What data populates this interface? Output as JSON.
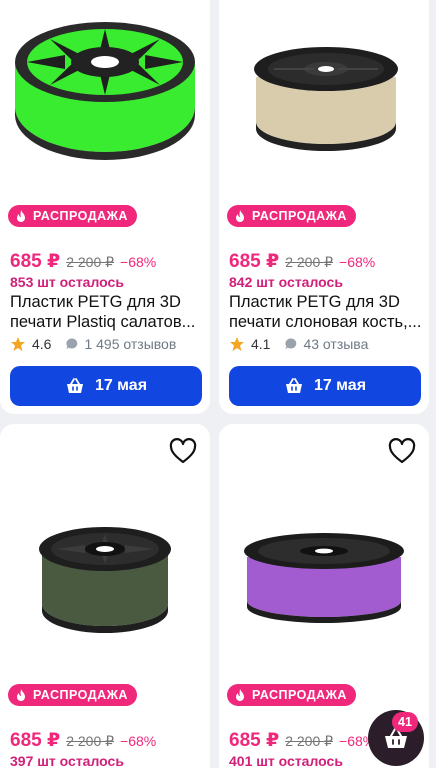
{
  "products": [
    {
      "badge": "РАСПРОДАЖА",
      "price": "685 ₽",
      "old_price": "2 200 ₽",
      "discount": "−68%",
      "stock": "853 шт осталось",
      "title_line1": "Пластик PETG для 3D",
      "title_line2": "печати Plastiq салатов...",
      "rating": "4.6",
      "reviews": "1 495 отзывов",
      "button": "17 мая",
      "filament_color": "#39ec30"
    },
    {
      "badge": "РАСПРОДАЖА",
      "price": "685 ₽",
      "old_price": "2 200 ₽",
      "discount": "−68%",
      "stock": "842 шт осталось",
      "title_line1": "Пластик PETG для 3D",
      "title_line2": "печати слоновая кость,...",
      "rating": "4.1",
      "reviews": "43 отзыва",
      "button": "17 мая",
      "filament_color": "#d9ccad"
    },
    {
      "badge": "РАСПРОДАЖА",
      "price": "685 ₽",
      "old_price": "2 200 ₽",
      "discount": "−68%",
      "stock": "397 шт осталось",
      "filament_color": "#4a5a40"
    },
    {
      "badge": "РАСПРОДАЖА",
      "price": "685 ₽",
      "old_price": "2 200 ₽",
      "discount": "−68%",
      "stock": "401 шт осталось",
      "filament_color": "#a25cd0"
    }
  ],
  "cart": {
    "count": "41"
  },
  "colors": {
    "accent": "#f0287c",
    "button": "#1246e0"
  }
}
